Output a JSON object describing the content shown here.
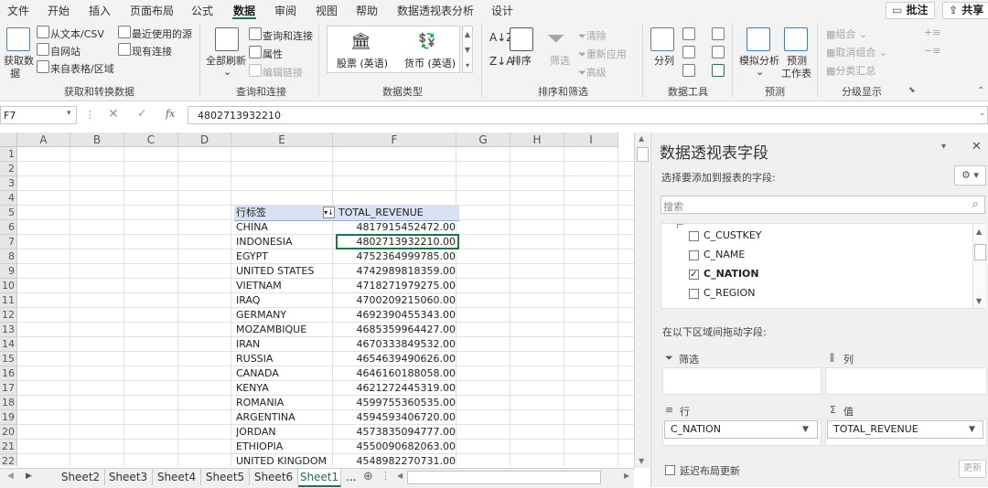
{
  "menu": {
    "tabs": [
      "文件",
      "开始",
      "插入",
      "页面布局",
      "公式",
      "数据",
      "审阅",
      "视图",
      "帮助",
      "数据透视表分析",
      "设计"
    ],
    "active": "数据",
    "comment_btn": "批注",
    "share_btn": "共享"
  },
  "ribbon": {
    "get_data": {
      "label1": "获取数",
      "label2": "据",
      "from_text_csv": "从文本/CSV",
      "from_web": "自网站",
      "from_table": "来自表格/区域",
      "recent_sources": "最近使用的源",
      "existing_conn": "现有连接",
      "group": "获取和转换数据"
    },
    "queries": {
      "refresh_all": "全部刷新",
      "queries_conn": "查询和连接",
      "properties": "属性",
      "edit_links": "编辑链接",
      "group": "查询和连接"
    },
    "data_types": {
      "stocks": "股票 (英语)",
      "currency": "货币 (英语)",
      "group": "数据类型"
    },
    "sort_filter": {
      "sort": "排序",
      "filter": "筛选",
      "clear": "清除",
      "reapply": "重新应用",
      "advanced": "高级",
      "group": "排序和筛选"
    },
    "data_tools": {
      "split": "分列",
      "group": "数据工具"
    },
    "forecast": {
      "whatif": "模拟分析",
      "forecast_sheet1": "预测",
      "forecast_sheet2": "工作表",
      "group": "预测"
    },
    "outline": {
      "group_btn": "组合",
      "ungroup_btn": "取消组合",
      "subtotal": "分类汇总",
      "group": "分级显示"
    }
  },
  "formula_bar": {
    "name_box": "F7",
    "value": "4802713932210",
    "fx": "fx"
  },
  "grid": {
    "columns": [
      "A",
      "B",
      "C",
      "D",
      "E",
      "F",
      "G",
      "H",
      "I"
    ],
    "rows": [
      "1",
      "2",
      "3",
      "4",
      "5",
      "6",
      "7",
      "8",
      "9",
      "10",
      "11",
      "12",
      "13",
      "14",
      "15",
      "16",
      "17",
      "18",
      "19",
      "20",
      "21",
      "22"
    ],
    "pivot_header": {
      "label": "行标签",
      "value": "TOTAL_REVENUE"
    },
    "pivot_rows": [
      {
        "name": "CHINA",
        "value": "4817915452472.00"
      },
      {
        "name": "INDONESIA",
        "value": "4802713932210.00"
      },
      {
        "name": "EGYPT",
        "value": "4752364999785.00"
      },
      {
        "name": "UNITED STATES",
        "value": "4742989818359.00"
      },
      {
        "name": "VIETNAM",
        "value": "4718271979275.00"
      },
      {
        "name": "IRAQ",
        "value": "4700209215060.00"
      },
      {
        "name": "GERMANY",
        "value": "4692390455343.00"
      },
      {
        "name": "MOZAMBIQUE",
        "value": "4685359964427.00"
      },
      {
        "name": "IRAN",
        "value": "4670333849532.00"
      },
      {
        "name": "RUSSIA",
        "value": "4654639490626.00"
      },
      {
        "name": "CANADA",
        "value": "4646160188058.00"
      },
      {
        "name": "KENYA",
        "value": "4621272445319.00"
      },
      {
        "name": "ROMANIA",
        "value": "4599755360535.00"
      },
      {
        "name": "ARGENTINA",
        "value": "4594593406720.00"
      },
      {
        "name": "JORDAN",
        "value": "4573835094777.00"
      },
      {
        "name": "ETHIOPIA",
        "value": "4550090682063.00"
      },
      {
        "name": "UNITED KINGDOM",
        "value": "4548982270731.00"
      }
    ]
  },
  "sheets": {
    "tabs": [
      "Sheet2",
      "Sheet3",
      "Sheet4",
      "Sheet5",
      "Sheet6",
      "Sheet1"
    ],
    "active": "Sheet1",
    "more": "..."
  },
  "pivot_pane": {
    "title": "数据透视表字段",
    "subtitle": "选择要添加到报表的字段:",
    "search_placeholder": "搜索",
    "fields": [
      {
        "name": "C_CUSTKEY",
        "checked": false
      },
      {
        "name": "C_NAME",
        "checked": false
      },
      {
        "name": "C_NATION",
        "checked": true
      },
      {
        "name": "C_REGION",
        "checked": false
      }
    ],
    "drag_hint": "在以下区域间拖动字段:",
    "filters": "筛选",
    "columns": "列",
    "rows": "行",
    "values": "值",
    "row_field": "C_NATION",
    "value_field": "TOTAL_REVENUE",
    "defer": "延迟布局更新",
    "update": "更新"
  },
  "colors": {
    "excel_green": "#217346",
    "pivot_header_bg": "#d9e1f2"
  }
}
